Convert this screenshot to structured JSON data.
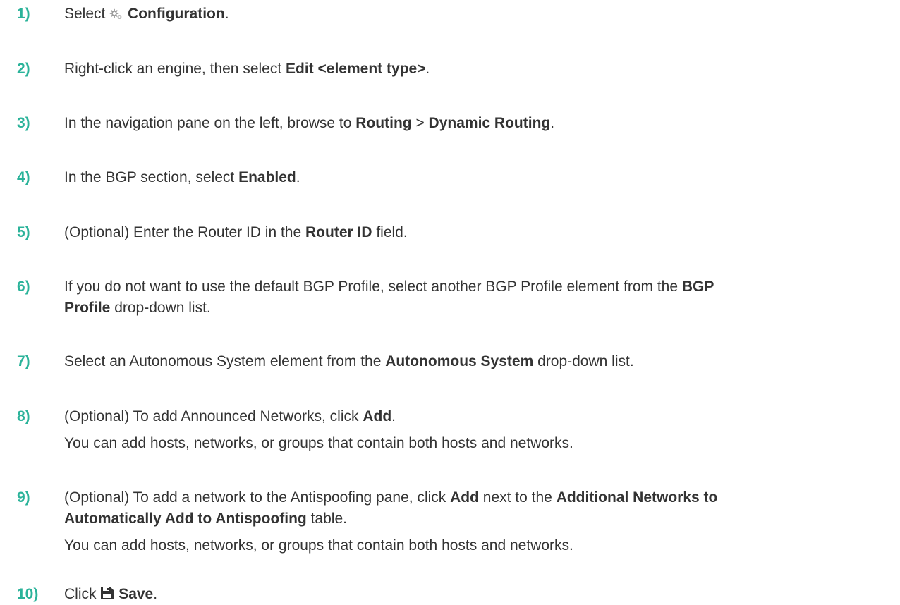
{
  "steps": [
    {
      "number": "1)",
      "pre": "Select",
      "icon": "gears-icon",
      "bold": "Configuration",
      "post": "."
    },
    {
      "number": "2)",
      "pre": "Right-click an engine, then select ",
      "bold": "Edit <element type>",
      "post": "."
    },
    {
      "number": "3)",
      "pre": "In the navigation pane on the left, browse to ",
      "bold1": "Routing",
      "mid": " > ",
      "bold2": "Dynamic Routing",
      "post": "."
    },
    {
      "number": "4)",
      "pre": "In the BGP section, select ",
      "bold": "Enabled",
      "post": "."
    },
    {
      "number": "5)",
      "pre": "(Optional) Enter the Router ID in the ",
      "bold": "Router ID",
      "post": " field."
    },
    {
      "number": "6)",
      "pre": "If you do not want to use the default BGP Profile, select another BGP Profile element from the ",
      "bold1": "BGP",
      "bold2": "Profile",
      "post": " drop-down list."
    },
    {
      "number": "7)",
      "pre": "Select an Autonomous System element from the ",
      "bold": "Autonomous System",
      "post": " drop-down list."
    },
    {
      "number": "8)",
      "pre": "(Optional) To add Announced Networks, click ",
      "bold": "Add",
      "post": ".",
      "note": "You can add hosts, networks, or groups that contain both hosts and networks."
    },
    {
      "number": "9)",
      "pre": "(Optional) To add a network to the Antispoofing pane, click ",
      "bold1": "Add",
      "mid": " next to the ",
      "bold2": "Additional Networks to",
      "bold3": "Automatically Add to Antispoofing",
      "post": " table.",
      "note": "You can add hosts, networks, or groups that contain both hosts and networks."
    },
    {
      "number": "10)",
      "pre": "Click",
      "icon": "save-icon",
      "bold": "Save",
      "post": "."
    }
  ]
}
